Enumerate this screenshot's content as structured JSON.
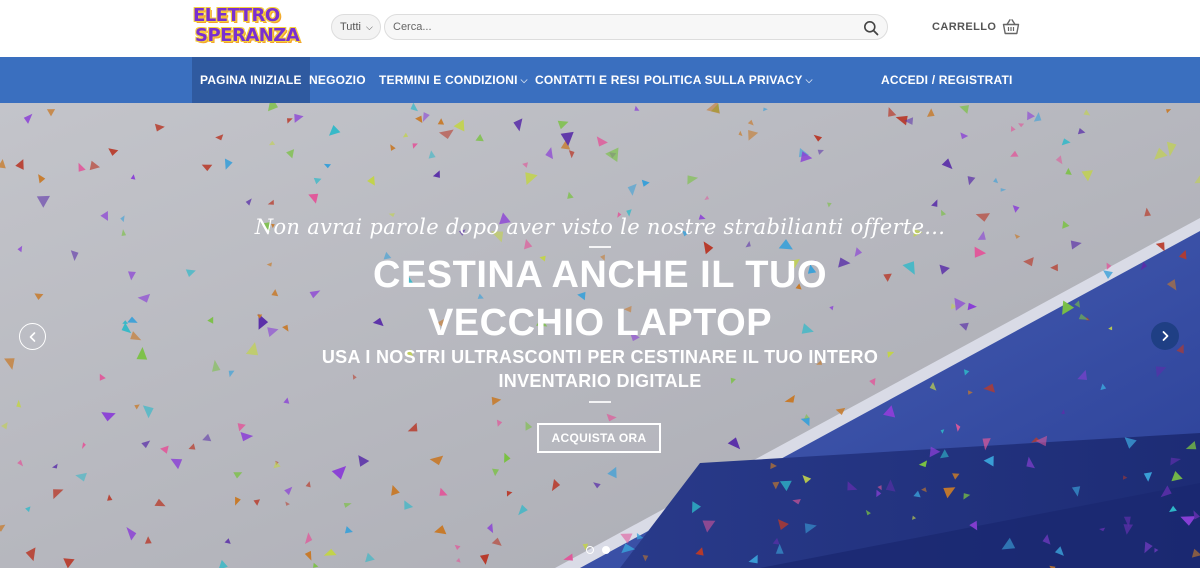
{
  "header": {
    "logo": {
      "line1": "ELETTRO",
      "line2": "SPERANZA"
    },
    "category_select": {
      "value": "Tutti"
    },
    "search": {
      "placeholder": "Cerca..."
    },
    "cart": {
      "label": "CARRELLO"
    }
  },
  "nav": {
    "items": [
      {
        "label": "PAGINA INIZIALE",
        "active": true
      },
      {
        "label": "NEGOZIO"
      },
      {
        "label": "TERMINI E CONDIZIONI",
        "dropdown": true
      },
      {
        "label": "CONTATTI E RESI"
      },
      {
        "label": "POLITICA SULLA PRIVACY",
        "dropdown": true
      }
    ],
    "account": "ACCEDI / REGISTRATI"
  },
  "hero": {
    "tagline": "Non avrai parole dopo aver visto le nostre strabilianti offerte...",
    "title_line1": "CESTINA ANCHE IL TUO",
    "title_line2": "VECCHIO LAPTOP",
    "subtitle_line1": "USA I NOSTRI ULTRASCONTI PER CESTINARE IL TUO INTERO",
    "subtitle_line2": "INVENTARIO DIGITALE",
    "cta": "ACQUISTA ORA",
    "slides_total": 2,
    "active_slide": 2
  },
  "colors": {
    "nav_bg": "#3a6fbf",
    "nav_active": "#2f5aa0",
    "hero_bg": "#b8b9bf",
    "laptop_blue": "#3450a8",
    "logo_purple": "#7a2fd0",
    "logo_yellow": "#f6d13b"
  },
  "icons": {
    "search": "search-icon",
    "cart": "basket-icon",
    "prev": "chevron-left-icon",
    "next": "chevron-right-icon"
  }
}
